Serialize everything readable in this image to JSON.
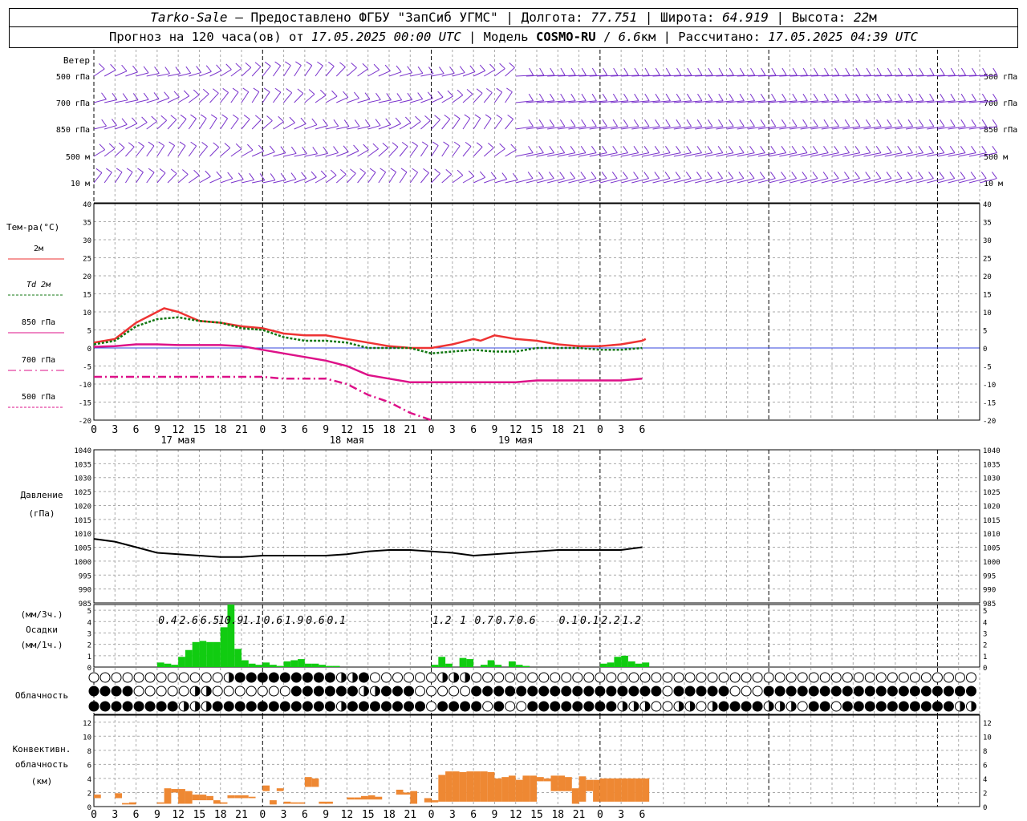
{
  "header": {
    "station": "Tarko-Sale",
    "dash": " – ",
    "provider": "Предоставлено ФГБУ \"ЗапСиб УГМС\"",
    "sep": " | ",
    "lon_label": "Долгота: ",
    "lon_value": "77.751",
    "lat_label": "Широта: ",
    "lat_value": "64.919",
    "alt_label": "Высота: ",
    "alt_value": "22",
    "alt_unit": "м",
    "forecast_label": "Прогноз на 120 часа(ов) от ",
    "forecast_start": "17.05.2025 00:00 UTC",
    "model_sep": "  | Модель ",
    "model_name": "COSMO-RU",
    "model_res_sep": " / ",
    "model_res": "6.6",
    "model_res_unit": "км",
    "calc_label": " | Рассчитано: ",
    "calc_time": "17.05.2025 04:39 UTC"
  },
  "labels": {
    "wind_title": "Ветер",
    "wind_levels": [
      "500 гПа",
      "700 гПа",
      "850 гПа",
      "500 м",
      "10  м"
    ],
    "temp_title": "Тем-ра(°C)",
    "temp_legend": [
      {
        "label": "2м",
        "color": "#ee3333",
        "dash": ""
      },
      {
        "label": "Td  2м",
        "color": "#117711",
        "dash": "3,2"
      },
      {
        "label": "850 гПа",
        "color": "#dd1188",
        "dash": ""
      },
      {
        "label": "700 гПа",
        "color": "#dd1188",
        "dash": "10,4,2,4"
      },
      {
        "label": "500 гПа",
        "color": "#dd1188",
        "dash": "3,2"
      }
    ],
    "pres_title": "Давление",
    "pres_unit": "(гПа)",
    "prec_unit3": "(мм/3ч.)",
    "prec_title": "Осадки",
    "prec_unit1": "(мм/1ч.)",
    "cloud_title": "Облачность",
    "conv_title1": "Конвективн.",
    "conv_title2": "облачность",
    "conv_unit": "(км)"
  },
  "chart_data": {
    "type": "meteogram",
    "x_hours": [
      0,
      126
    ],
    "hour_tick_labels": [
      "0",
      "3",
      "6",
      "9",
      "12",
      "15",
      "18",
      "21",
      "0",
      "3",
      "6",
      "9",
      "12",
      "15",
      "18",
      "21",
      "0",
      "3",
      "6",
      "9",
      "12",
      "15",
      "18",
      "21",
      "0",
      "3",
      "6"
    ],
    "day_labels": [
      {
        "hour": 12,
        "label": "17 мая"
      },
      {
        "hour": 36,
        "label": "18 мая"
      },
      {
        "hour": 60,
        "label": "19 мая"
      }
    ],
    "temperature": {
      "ylim": [
        -20,
        40
      ],
      "yticks": [
        -20,
        -15,
        -10,
        -5,
        0,
        5,
        10,
        15,
        20,
        25,
        30,
        35,
        40
      ],
      "series": [
        {
          "name": "2м",
          "color": "#ee3333",
          "points": [
            [
              0,
              1.5
            ],
            [
              3,
              2.5
            ],
            [
              6,
              7
            ],
            [
              9,
              10
            ],
            [
              10,
              11
            ],
            [
              12,
              10
            ],
            [
              15,
              7.5
            ],
            [
              18,
              7
            ],
            [
              21,
              6
            ],
            [
              24,
              5.5
            ],
            [
              27,
              4
            ],
            [
              30,
              3.5
            ],
            [
              33,
              3.5
            ],
            [
              36,
              2.5
            ],
            [
              39,
              1.5
            ],
            [
              42,
              0.5
            ],
            [
              45,
              0
            ],
            [
              48,
              0
            ],
            [
              51,
              1
            ],
            [
              52,
              1.5
            ],
            [
              54,
              2.5
            ],
            [
              55,
              2
            ],
            [
              57,
              3.5
            ],
            [
              60,
              2.5
            ],
            [
              63,
              2
            ],
            [
              66,
              1
            ],
            [
              69,
              0.5
            ],
            [
              72,
              0.5
            ],
            [
              75,
              1
            ],
            [
              78,
              2
            ],
            [
              78.5,
              2.5
            ]
          ]
        },
        {
          "name": "Td  2м",
          "color": "#117711",
          "points": [
            [
              0,
              1
            ],
            [
              3,
              2
            ],
            [
              6,
              6
            ],
            [
              9,
              8
            ],
            [
              12,
              8.5
            ],
            [
              15,
              7.5
            ],
            [
              18,
              7
            ],
            [
              21,
              5.5
            ],
            [
              24,
              5
            ],
            [
              27,
              3
            ],
            [
              30,
              2
            ],
            [
              33,
              2
            ],
            [
              36,
              1.5
            ],
            [
              39,
              0
            ],
            [
              42,
              0
            ],
            [
              45,
              0
            ],
            [
              48,
              -1.5
            ],
            [
              51,
              -1
            ],
            [
              54,
              -0.5
            ],
            [
              57,
              -1
            ],
            [
              60,
              -1
            ],
            [
              63,
              0
            ],
            [
              66,
              0
            ],
            [
              69,
              0
            ],
            [
              72,
              -0.5
            ],
            [
              75,
              -0.5
            ],
            [
              78,
              0
            ]
          ]
        },
        {
          "name": "850 гПа",
          "color": "#dd1188",
          "points": [
            [
              0,
              0.3
            ],
            [
              3,
              0.5
            ],
            [
              6,
              1
            ],
            [
              9,
              1
            ],
            [
              12,
              0.8
            ],
            [
              15,
              0.8
            ],
            [
              18,
              0.8
            ],
            [
              21,
              0.5
            ],
            [
              24,
              -0.5
            ],
            [
              27,
              -1.5
            ],
            [
              30,
              -2.5
            ],
            [
              33,
              -3.5
            ],
            [
              36,
              -5
            ],
            [
              39,
              -7.5
            ],
            [
              42,
              -8.5
            ],
            [
              45,
              -9.5
            ],
            [
              48,
              -9.5
            ],
            [
              51,
              -9.5
            ],
            [
              54,
              -9.5
            ],
            [
              57,
              -9.5
            ],
            [
              60,
              -9.5
            ],
            [
              63,
              -9
            ],
            [
              66,
              -9
            ],
            [
              69,
              -9
            ],
            [
              72,
              -9
            ],
            [
              75,
              -9
            ],
            [
              78,
              -8.5
            ]
          ]
        },
        {
          "name": "700 гПа",
          "color": "#dd1188",
          "points": [
            [
              0,
              -8
            ],
            [
              3,
              -8
            ],
            [
              6,
              -8
            ],
            [
              9,
              -8
            ],
            [
              12,
              -8
            ],
            [
              15,
              -8
            ],
            [
              18,
              -8
            ],
            [
              21,
              -8
            ],
            [
              24,
              -8
            ],
            [
              27,
              -8.5
            ],
            [
              30,
              -8.5
            ],
            [
              33,
              -8.5
            ],
            [
              36,
              -10
            ],
            [
              39,
              -13
            ],
            [
              42,
              -15
            ],
            [
              45,
              -18
            ],
            [
              48,
              -20
            ]
          ]
        },
        {
          "name": "500 гПа",
          "color": "#dd1188",
          "points": []
        }
      ]
    },
    "pressure": {
      "ylim": [
        985,
        1040
      ],
      "yticks": [
        985,
        990,
        995,
        1000,
        1005,
        1010,
        1015,
        1020,
        1025,
        1030,
        1035,
        1040
      ],
      "points": [
        [
          0,
          1008
        ],
        [
          3,
          1007
        ],
        [
          6,
          1005
        ],
        [
          9,
          1003
        ],
        [
          12,
          1002.5
        ],
        [
          15,
          1002
        ],
        [
          18,
          1001.5
        ],
        [
          21,
          1001.5
        ],
        [
          24,
          1002
        ],
        [
          27,
          1002
        ],
        [
          30,
          1002
        ],
        [
          33,
          1002
        ],
        [
          36,
          1002.5
        ],
        [
          39,
          1003.5
        ],
        [
          42,
          1004
        ],
        [
          45,
          1004
        ],
        [
          48,
          1003.5
        ],
        [
          51,
          1003
        ],
        [
          54,
          1002
        ],
        [
          57,
          1002.5
        ],
        [
          60,
          1003
        ],
        [
          63,
          1003.5
        ],
        [
          66,
          1004
        ],
        [
          69,
          1004
        ],
        [
          72,
          1004
        ],
        [
          75,
          1004
        ],
        [
          78,
          1005
        ]
      ]
    },
    "precipitation": {
      "ylim": [
        0,
        5.5
      ],
      "yticks": [
        0,
        1,
        2,
        3,
        4,
        5
      ],
      "three_hour_totals": [
        {
          "hour": 10.5,
          "label": "0.4"
        },
        {
          "hour": 13.5,
          "label": "2.6"
        },
        {
          "hour": 16.5,
          "label": "6.5"
        },
        {
          "hour": 19.5,
          "label": "10.9"
        },
        {
          "hour": 22.5,
          "label": "1.1"
        },
        {
          "hour": 25.5,
          "label": "0.6"
        },
        {
          "hour": 28.5,
          "label": "1.9"
        },
        {
          "hour": 31.5,
          "label": "0.6"
        },
        {
          "hour": 34.5,
          "label": "0.1"
        },
        {
          "hour": 49.5,
          "label": "1.2"
        },
        {
          "hour": 52.5,
          "label": "1"
        },
        {
          "hour": 55.5,
          "label": "0.7"
        },
        {
          "hour": 58.5,
          "label": "0.7"
        },
        {
          "hour": 61.5,
          "label": "0.6"
        },
        {
          "hour": 67.5,
          "label": "0.1"
        },
        {
          "hour": 70.5,
          "label": "0.1"
        },
        {
          "hour": 73.5,
          "label": "2.2"
        },
        {
          "hour": 76.5,
          "label": "1.2"
        }
      ],
      "hourly": [
        [
          9,
          0.4
        ],
        [
          10,
          0.3
        ],
        [
          11,
          0.2
        ],
        [
          12,
          0.9
        ],
        [
          13,
          1.5
        ],
        [
          14,
          2.2
        ],
        [
          15,
          2.3
        ],
        [
          16,
          2.2
        ],
        [
          17,
          2.2
        ],
        [
          18,
          3.5
        ],
        [
          19,
          5.5
        ],
        [
          20,
          1.6
        ],
        [
          21,
          0.6
        ],
        [
          22,
          0.3
        ],
        [
          23,
          0.2
        ],
        [
          24,
          0.4
        ],
        [
          25,
          0.2
        ],
        [
          26,
          0.1
        ],
        [
          27,
          0.5
        ],
        [
          28,
          0.6
        ],
        [
          29,
          0.7
        ],
        [
          30,
          0.3
        ],
        [
          31,
          0.3
        ],
        [
          32,
          0.2
        ],
        [
          33,
          0.1
        ],
        [
          34,
          0.1
        ],
        [
          48,
          0.2
        ],
        [
          49,
          0.9
        ],
        [
          50,
          0.3
        ],
        [
          52,
          0.8
        ],
        [
          53,
          0.7
        ],
        [
          55,
          0.2
        ],
        [
          56,
          0.6
        ],
        [
          57,
          0.2
        ],
        [
          59,
          0.5
        ],
        [
          60,
          0.2
        ],
        [
          61,
          0.1
        ],
        [
          72,
          0.3
        ],
        [
          73,
          0.4
        ],
        [
          74,
          0.9
        ],
        [
          75,
          1.0
        ],
        [
          76,
          0.5
        ],
        [
          77,
          0.3
        ],
        [
          78,
          0.4
        ]
      ]
    },
    "cloudiness": {
      "rows": [
        "000000000000hfffffffffhhf000000hhh000000000000000000000000000000000000000000000000000000000000000000000000000000000000000000000000000000000000000000000000",
        "ffff00000hh0000000ffffffhhfff00000fffffffffffffffff0fffff000fffffffffffffffffffffffffffffffffffffffffffffffff",
        "ffffffffhhhfffffffffffhfffffff0ffff0f00ffffffffhhh00hh0hffffhhh0ff0ffffffffffhhh0h"
      ]
    },
    "convective": {
      "ylim": [
        0,
        13
      ],
      "yticks": [
        0,
        2,
        4,
        6,
        8,
        10,
        12
      ],
      "bars": [
        [
          0,
          1.2,
          1.7
        ],
        [
          3,
          1.2,
          1.9
        ],
        [
          4,
          0.3,
          0.5
        ],
        [
          5,
          0.3,
          0.6
        ],
        [
          9,
          0.4,
          0.6
        ],
        [
          10,
          0.4,
          2.6
        ],
        [
          11,
          2.0,
          2.5
        ],
        [
          12,
          0.4,
          2.5
        ],
        [
          13,
          0.4,
          2.2
        ],
        [
          14,
          0.9,
          1.7
        ],
        [
          15,
          0.9,
          1.7
        ],
        [
          16,
          0.9,
          1.5
        ],
        [
          17,
          0.4,
          0.9
        ],
        [
          18,
          0.4,
          0.6
        ],
        [
          19,
          1.2,
          1.6
        ],
        [
          20,
          1.2,
          1.6
        ],
        [
          21,
          1.2,
          1.6
        ],
        [
          22,
          1.2,
          1.4
        ],
        [
          24,
          2.2,
          3.0
        ],
        [
          25,
          0.3,
          0.9
        ],
        [
          26,
          2.2,
          2.6
        ],
        [
          27,
          0.4,
          0.7
        ],
        [
          28,
          0.4,
          0.6
        ],
        [
          29,
          0.4,
          0.6
        ],
        [
          30,
          2.8,
          4.2
        ],
        [
          31,
          2.8,
          4.0
        ],
        [
          32,
          0.4,
          0.7
        ],
        [
          33,
          0.4,
          0.7
        ],
        [
          36,
          1.0,
          1.3
        ],
        [
          37,
          1.0,
          1.3
        ],
        [
          38,
          1.0,
          1.5
        ],
        [
          39,
          1.0,
          1.6
        ],
        [
          40,
          1.0,
          1.4
        ],
        [
          43,
          1.7,
          2.4
        ],
        [
          44,
          1.7,
          2.0
        ],
        [
          45,
          0.4,
          2.2
        ],
        [
          47,
          0.6,
          1.2
        ],
        [
          48,
          0.6,
          0.9
        ],
        [
          49,
          0.7,
          4.5
        ],
        [
          50,
          0.7,
          5.0
        ],
        [
          51,
          0.7,
          5.0
        ],
        [
          52,
          0.7,
          4.9
        ],
        [
          53,
          0.7,
          5.0
        ],
        [
          54,
          0.7,
          5.0
        ],
        [
          55,
          0.7,
          5.0
        ],
        [
          56,
          0.7,
          4.9
        ],
        [
          57,
          0.7,
          4.0
        ],
        [
          58,
          0.7,
          4.2
        ],
        [
          59,
          0.7,
          4.4
        ],
        [
          60,
          0.7,
          3.8
        ],
        [
          61,
          0.7,
          4.4
        ],
        [
          62,
          0.7,
          4.4
        ],
        [
          63,
          3.6,
          4.2
        ],
        [
          64,
          3.6,
          4.0
        ],
        [
          65,
          2.2,
          4.4
        ],
        [
          66,
          2.2,
          4.4
        ],
        [
          67,
          2.2,
          4.2
        ],
        [
          68,
          0.4,
          2.6
        ],
        [
          69,
          0.7,
          4.3
        ],
        [
          70,
          2.2,
          3.8
        ],
        [
          71,
          0.7,
          3.8
        ],
        [
          72,
          0.7,
          4.0
        ],
        [
          73,
          0.7,
          4.0
        ],
        [
          74,
          0.7,
          4.0
        ],
        [
          75,
          0.7,
          4.0
        ],
        [
          76,
          0.7,
          4.0
        ],
        [
          77,
          0.7,
          4.0
        ],
        [
          78,
          0.7,
          4.0
        ]
      ]
    }
  }
}
